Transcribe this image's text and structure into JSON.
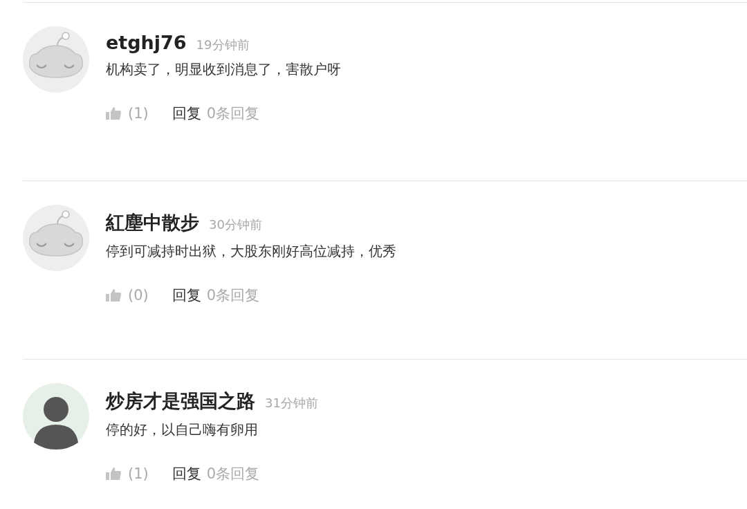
{
  "comments": [
    {
      "avatar": {
        "kind": "default"
      },
      "username": "etghj76",
      "time": "19分钟前",
      "text": "机构卖了，明显收到消息了，害散户呀",
      "likes": "(1)",
      "reply_label": "回复",
      "reply_count": "0条回复"
    },
    {
      "avatar": {
        "kind": "default"
      },
      "username": "紅塵中散步",
      "time": "30分钟前",
      "text": "停到可减持时出狱，大股东刚好高位减持，优秀",
      "likes": "(0)",
      "reply_label": "回复",
      "reply_count": "0条回复"
    },
    {
      "avatar": {
        "kind": "photo"
      },
      "username": "炒房才是强国之路",
      "time": "31分钟前",
      "text": "停的好，以自己嗨有卵用",
      "likes": "(1)",
      "reply_label": "回复",
      "reply_count": "0条回复"
    }
  ]
}
